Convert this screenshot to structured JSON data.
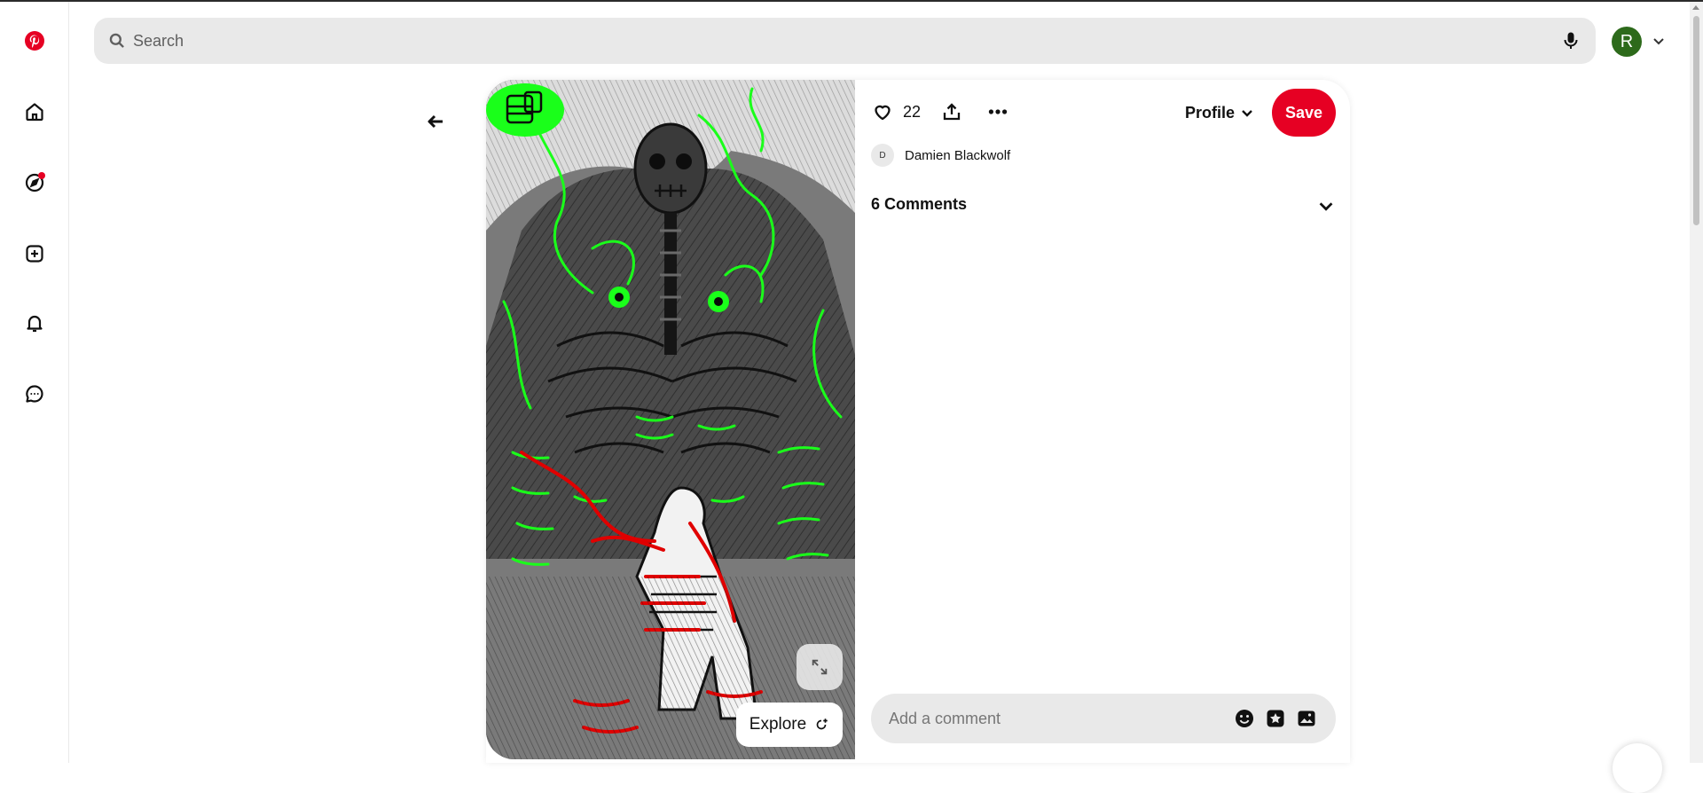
{
  "search": {
    "placeholder": "Search"
  },
  "account": {
    "initial": "R",
    "avatar_color": "#2d6a1b"
  },
  "rail": {
    "items": [
      {
        "name": "logo",
        "icon": "pinterest-logo"
      },
      {
        "name": "home",
        "icon": "home-icon"
      },
      {
        "name": "explore",
        "icon": "compass-icon",
        "has_notification_dot": true
      },
      {
        "name": "create",
        "icon": "plus-square-icon"
      },
      {
        "name": "notifications",
        "icon": "bell-icon"
      },
      {
        "name": "messages",
        "icon": "chat-bubble-icon"
      }
    ]
  },
  "pin": {
    "like_count": "22",
    "profile_label": "Profile",
    "save_label": "Save",
    "author": {
      "initial": "D",
      "name": "Damien Blackwolf"
    },
    "comments_label": "6 Comments",
    "comment_placeholder": "Add a comment",
    "explore_label": "Explore"
  },
  "colors": {
    "brand_red": "#e60023",
    "neon_green": "#1aff1a",
    "blood_red": "#e00000",
    "surface_gray": "#e9e9e9"
  }
}
